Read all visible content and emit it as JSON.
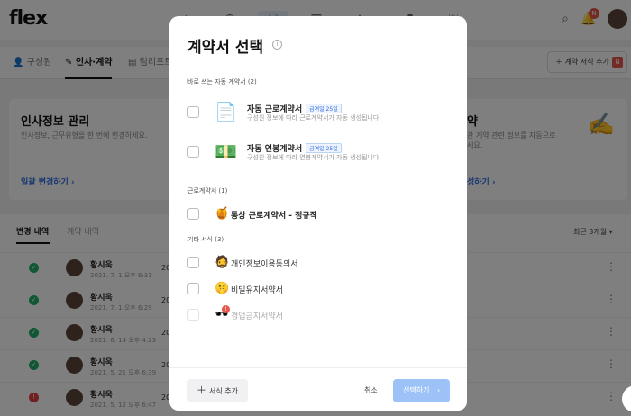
{
  "app": {
    "logo": "flex",
    "notification_count": "N"
  },
  "subnav": {
    "tabs": [
      {
        "label": "구성원",
        "icon": "person-icon"
      },
      {
        "label": "인사·계약",
        "icon": "person-edit-icon",
        "active": true
      },
      {
        "label": "팀리포트",
        "icon": "report-icon"
      }
    ],
    "add_contract_button": "계약 서식 추가",
    "add_contract_badge": "N"
  },
  "cards": [
    {
      "title": "인사정보 관리",
      "desc": "인사정보, 근무유형을 한 번에 변경하세요.",
      "link": "일괄 변경하기"
    },
    {
      "title": "약",
      "desc": "관 계약 관련 정보를 자동으로",
      "desc2": "세요.",
      "link": "성하기"
    }
  ],
  "list": {
    "tabs": [
      "변경 내역",
      "계약 내역"
    ],
    "recent_filter": "최근 3개월",
    "rows": [
      {
        "name": "황시욱",
        "date": "2021. 7. 1 오후 6:31",
        "year": "20",
        "status": "ok"
      },
      {
        "name": "황시욱",
        "date": "2021. 7. 1 오후 6:29",
        "year": "20",
        "status": "ok"
      },
      {
        "name": "황시욱",
        "date": "2021. 6. 14 오후 4:23",
        "year": "20",
        "status": "ok"
      },
      {
        "name": "황시욱",
        "date": "2021. 5. 21 오후 6:39",
        "year": "20",
        "status": "ok"
      },
      {
        "name": "황시욱",
        "date": "2021. 5. 12 오후 6:47",
        "year": "20",
        "status": "warn"
      }
    ]
  },
  "modal": {
    "title": "계약서 선택",
    "sections": {
      "frequent": "바로 쓰는 자동 계약서 (2)",
      "labor": "근로계약서 (1)",
      "other": "기타 서식 (3)"
    },
    "auto_options": [
      {
        "title": "자동 근로계약서",
        "tag": "급여일 25일",
        "desc": "구성원 정보에 따라 근로계약서가 자동 생성됩니다.",
        "emoji": "📄✨"
      },
      {
        "title": "자동 연봉계약서",
        "tag": "급여일 25일",
        "desc": "구성원 정보에 따라 연봉계약서가 자동 생성됩니다.",
        "emoji": "💵✨"
      }
    ],
    "labor_options": [
      {
        "title": "통상 근로계약서 - 정규직",
        "emoji": "🍯"
      }
    ],
    "other_options": [
      {
        "title": "개인정보이용동의서",
        "emoji": "🧔"
      },
      {
        "title": "비밀유지서약서",
        "emoji": "🤫"
      },
      {
        "title": "경업금지서약서",
        "emoji": "🕶️",
        "badge": "!"
      }
    ],
    "footer": {
      "add_form": "서식 추가",
      "cancel": "취소",
      "select": "선택하기"
    }
  }
}
